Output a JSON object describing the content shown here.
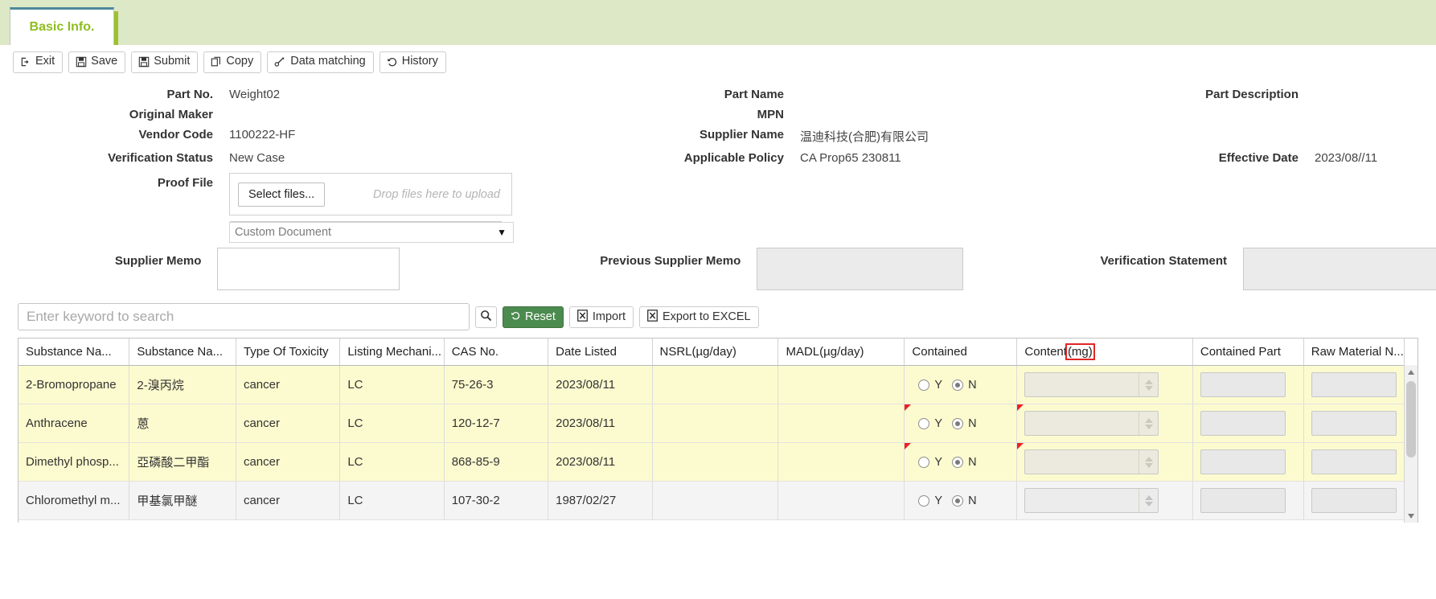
{
  "tab": {
    "label": "Basic Info."
  },
  "toolbar": {
    "exit": "Exit",
    "save": "Save",
    "submit": "Submit",
    "copy": "Copy",
    "data_matching": "Data matching",
    "history": "History"
  },
  "form": {
    "part_no_label": "Part No.",
    "part_no_value": "Weight02",
    "part_name_label": "Part Name",
    "part_name_value": "",
    "part_description_label": "Part Description",
    "part_description_value": "",
    "original_maker_label": "Original Maker",
    "original_maker_value": "",
    "mpn_label": "MPN",
    "mpn_value": "",
    "vendor_code_label": "Vendor Code",
    "vendor_code_value": "1100222-HF",
    "supplier_name_label": "Supplier Name",
    "supplier_name_value": "温迪科技(合肥)有限公司",
    "verification_status_label": "Verification Status",
    "verification_status_value": "New Case",
    "applicable_policy_label": "Applicable Policy",
    "applicable_policy_value": "CA Prop65 230811",
    "effective_date_label": "Effective Date",
    "effective_date_value": "2023/08//11",
    "proof_file_label": "Proof File",
    "select_files_label": "Select files...",
    "drop_hint": "Drop files here to upload",
    "document_type_selected": "Custom Document",
    "supplier_memo_label": "Supplier Memo",
    "supplier_memo_value": "",
    "previous_supplier_memo_label": "Previous Supplier Memo",
    "previous_supplier_memo_value": "",
    "verification_statement_label": "Verification Statement",
    "verification_statement_value": ""
  },
  "search": {
    "placeholder": "Enter keyword to search",
    "value": "",
    "reset_label": "Reset",
    "import_label": "Import",
    "export_label": "Export to EXCEL"
  },
  "grid": {
    "columns": [
      "Substance Na...",
      "Substance Na...",
      "Type Of Toxicity",
      "Listing Mechani...",
      "CAS No.",
      "Date Listed",
      "NSRL(µg/day)",
      "MADL(µg/day)",
      "Contained",
      "Content",
      "Contained Part",
      "Raw Material N..."
    ],
    "content_unit_highlight": "(mg)",
    "radio_yes": "Y",
    "radio_no": "N",
    "rows": [
      {
        "substance_en": "2-Bromopropane",
        "substance_cn": "2-溴丙烷",
        "toxicity": "cancer",
        "listing": "LC",
        "cas": "75-26-3",
        "date_listed": "2023/08/11",
        "nsrl": "",
        "madl": "",
        "contained": "N",
        "content": "",
        "contained_part": "",
        "raw_material": "",
        "highlight": true,
        "flagged": false
      },
      {
        "substance_en": "Anthracene",
        "substance_cn": "蒽",
        "toxicity": "cancer",
        "listing": "LC",
        "cas": "120-12-7",
        "date_listed": "2023/08/11",
        "nsrl": "",
        "madl": "",
        "contained": "N",
        "content": "",
        "contained_part": "",
        "raw_material": "",
        "highlight": true,
        "flagged": true
      },
      {
        "substance_en": "Dimethyl phosp...",
        "substance_cn": "亞磷酸二甲酯",
        "toxicity": "cancer",
        "listing": "LC",
        "cas": "868-85-9",
        "date_listed": "2023/08/11",
        "nsrl": "",
        "madl": "",
        "contained": "N",
        "content": "",
        "contained_part": "",
        "raw_material": "",
        "highlight": true,
        "flagged": true
      },
      {
        "substance_en": "Chloromethyl m...",
        "substance_cn": "甲基氯甲醚",
        "toxicity": "cancer",
        "listing": "LC",
        "cas": "107-30-2",
        "date_listed": "1987/02/27",
        "nsrl": "",
        "madl": "",
        "contained": "N",
        "content": "",
        "contained_part": "",
        "raw_material": "",
        "highlight": false,
        "flagged": false
      }
    ]
  },
  "colors": {
    "tab_strip": "#dde8c6",
    "tab_text": "#8fbd1f",
    "tab_top_border": "#4c8a9a",
    "reset_button": "#4c8b4f",
    "row_highlight": "#fcfbcf",
    "flag_marker": "#ef2020",
    "red_outline": "#e22626"
  }
}
